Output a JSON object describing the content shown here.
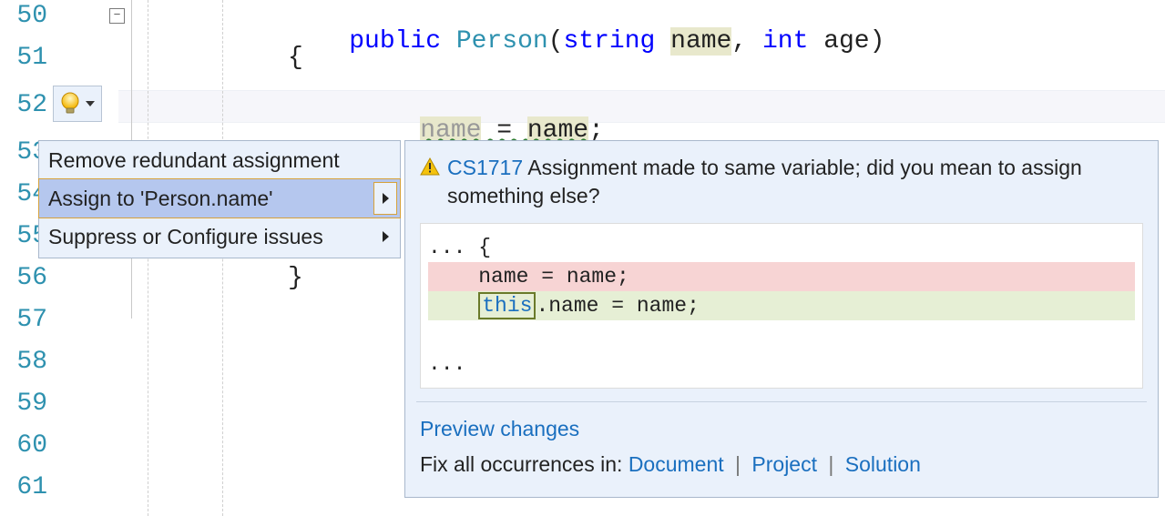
{
  "line_numbers": {
    "n50": "50",
    "n51": "51",
    "n52": "52",
    "n53": "53",
    "n54": "54",
    "n55": "55",
    "n56": "56",
    "n57": "57",
    "n58": "58",
    "n59": "59",
    "n60": "60",
    "n61": "61"
  },
  "code": {
    "l50": {
      "kw": "public",
      "space1": " ",
      "type": "Person",
      "sig1": "(",
      "kw2": "string",
      "space2": " ",
      "param_hl": "name",
      "sig2": ", ",
      "kw3": "int",
      "space3": " ",
      "param2": "age",
      "sig3": ")"
    },
    "l51": {
      "brace": "{"
    },
    "l52": {
      "lhs_hl": "name",
      "eq": " = ",
      "rhs_hl": "name",
      "semi": ";"
    },
    "l56": {
      "brace": "}"
    }
  },
  "foldbox_glyph": "−",
  "quick_actions": {
    "item0": "Remove redundant assignment",
    "item1": "Assign to 'Person.name'",
    "item2": "Suppress or Configure issues"
  },
  "preview": {
    "warning_code": "CS1717",
    "warning_text": " Assignment made to same variable; did you mean to assign something else?",
    "dots_top": "...",
    "brace_open": "{",
    "del_line": "    name = name;",
    "add_prefix": "    ",
    "add_this": "this",
    "add_rest": ".name = name;",
    "dots_bottom": "...",
    "preview_link": "Preview changes",
    "fix_label": "Fix all occurrences in: ",
    "scope_document": "Document",
    "scope_project": "Project",
    "scope_solution": "Solution",
    "sep": "|"
  }
}
